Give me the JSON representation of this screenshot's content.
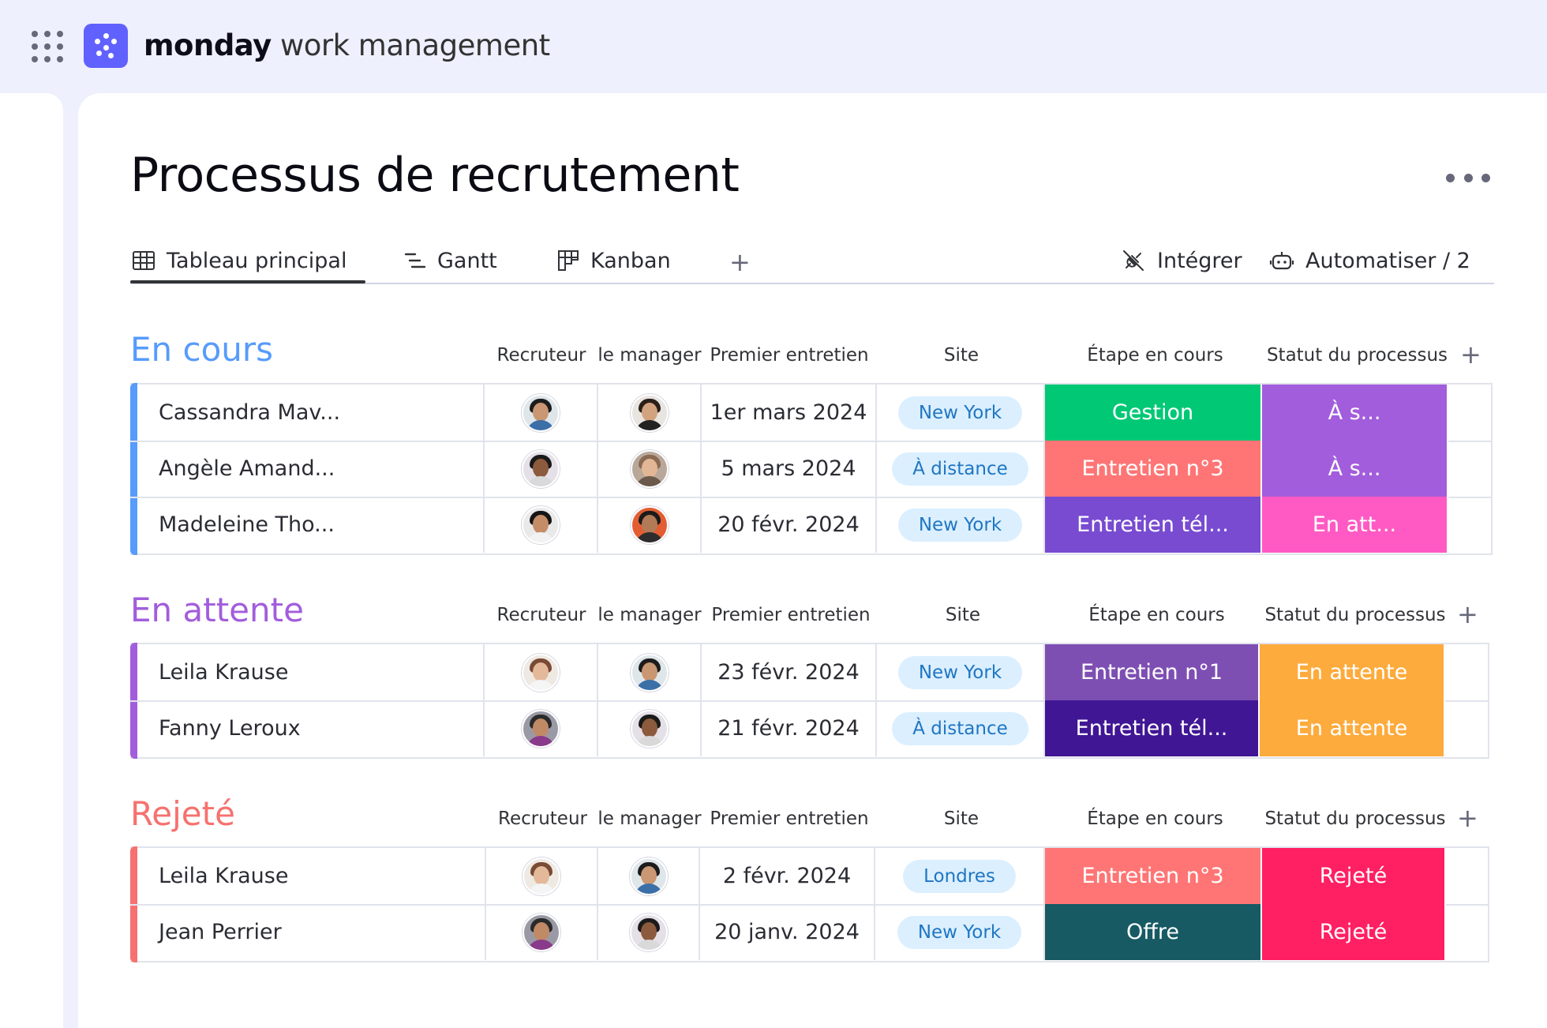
{
  "app": {
    "brand_bold": "monday",
    "brand_rest": " work management",
    "accent": "#6161ff"
  },
  "board": {
    "title": "Processus de recrutement",
    "more_icon": "more-horizontal-icon"
  },
  "tabs": [
    {
      "label": "Tableau principal",
      "icon": "table-icon",
      "active": true
    },
    {
      "label": "Gantt",
      "icon": "gantt-icon",
      "active": false
    },
    {
      "label": "Kanban",
      "icon": "kanban-icon",
      "active": false
    }
  ],
  "tab_add": "+",
  "actions": {
    "integrate": "Intégrer",
    "automate": "Automatiser / 2"
  },
  "columns": [
    "Recruteur",
    "le manager",
    "Premier entretien",
    "Site",
    "Étape en cours",
    "Statut du processus"
  ],
  "column_add": "+",
  "colors": {
    "stage_gestion": "#00c875",
    "stage_entretien3": "#ff7575",
    "stage_tel_violet": "#784bd1",
    "stage_entretien1": "#7e4fb3",
    "stage_tel_dark": "#401694",
    "stage_offre": "#175a63",
    "status_a_s": "#a25ddc",
    "status_en_att": "#ff5ac4",
    "status_en_attente": "#fdab3d",
    "status_rejete": "#ff1f63"
  },
  "groups": [
    {
      "title": "En cours",
      "color": "#579bfc",
      "rows": [
        {
          "name": "Cassandra Mav...",
          "date": "1er mars 2024",
          "site": "New York",
          "stage": "Gestion",
          "stage_color": "#00c875",
          "status": "À s...",
          "status_color": "#a25ddc"
        },
        {
          "name": "Angèle Amand...",
          "date": "5 mars 2024",
          "site": "À distance",
          "stage": "Entretien n°3",
          "stage_color": "#ff7575",
          "status": "À s...",
          "status_color": "#a25ddc"
        },
        {
          "name": "Madeleine Tho...",
          "date": "20 févr. 2024",
          "site": "New York",
          "stage": "Entretien tél...",
          "stage_color": "#784bd1",
          "status": "En att...",
          "status_color": "#ff5ac4"
        }
      ]
    },
    {
      "title": "En attente",
      "color": "#a25ddc",
      "rows": [
        {
          "name": "Leila Krause",
          "date": "23 févr. 2024",
          "site": "New York",
          "stage": "Entretien n°1",
          "stage_color": "#7e4fb3",
          "status": "En attente",
          "status_color": "#fdab3d"
        },
        {
          "name": "Fanny Leroux",
          "date": "21 févr. 2024",
          "site": "À distance",
          "stage": "Entretien tél...",
          "stage_color": "#401694",
          "status": "En attente",
          "status_color": "#fdab3d"
        }
      ]
    },
    {
      "title": "Rejeté",
      "color": "#f6716f",
      "rows": [
        {
          "name": "Leila Krause",
          "date": "2 févr. 2024",
          "site": "Londres",
          "stage": "Entretien n°3",
          "stage_color": "#ff7575",
          "status": "Rejeté",
          "status_color": "#ff1f63"
        },
        {
          "name": "Jean Perrier",
          "date": "20 janv. 2024",
          "site": "New York",
          "stage": "Offre",
          "stage_color": "#175a63",
          "status": "Rejeté",
          "status_color": "#ff1f63"
        }
      ]
    }
  ]
}
